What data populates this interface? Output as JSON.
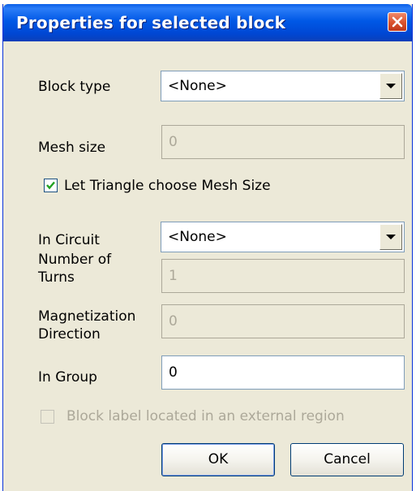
{
  "window": {
    "title": "Properties for selected block",
    "close_icon": "close-icon"
  },
  "block_type": {
    "label": "Block type",
    "selected": "<None>"
  },
  "mesh_size": {
    "label": "Mesh size",
    "value": "0",
    "enabled": false
  },
  "auto_mesh": {
    "label": "Let Triangle choose Mesh Size",
    "checked": true
  },
  "in_circuit": {
    "label": "In Circuit",
    "selected": "<None>"
  },
  "number_of_turns": {
    "label": "Number of Turns",
    "value": "1",
    "enabled": false
  },
  "magnetization_direction": {
    "label": "Magnetization Direction",
    "value": "0",
    "enabled": false
  },
  "in_group": {
    "label": "In Group",
    "value": "0",
    "enabled": true
  },
  "external_region": {
    "label": "Block label located in an external region",
    "checked": false,
    "enabled": false
  },
  "buttons": {
    "ok": "OK",
    "cancel": "Cancel"
  },
  "colors": {
    "titlebar": "#0058e6",
    "dialog_bg": "#ece9d8",
    "close_button": "#d9512c",
    "disabled_text": "#aca899"
  }
}
